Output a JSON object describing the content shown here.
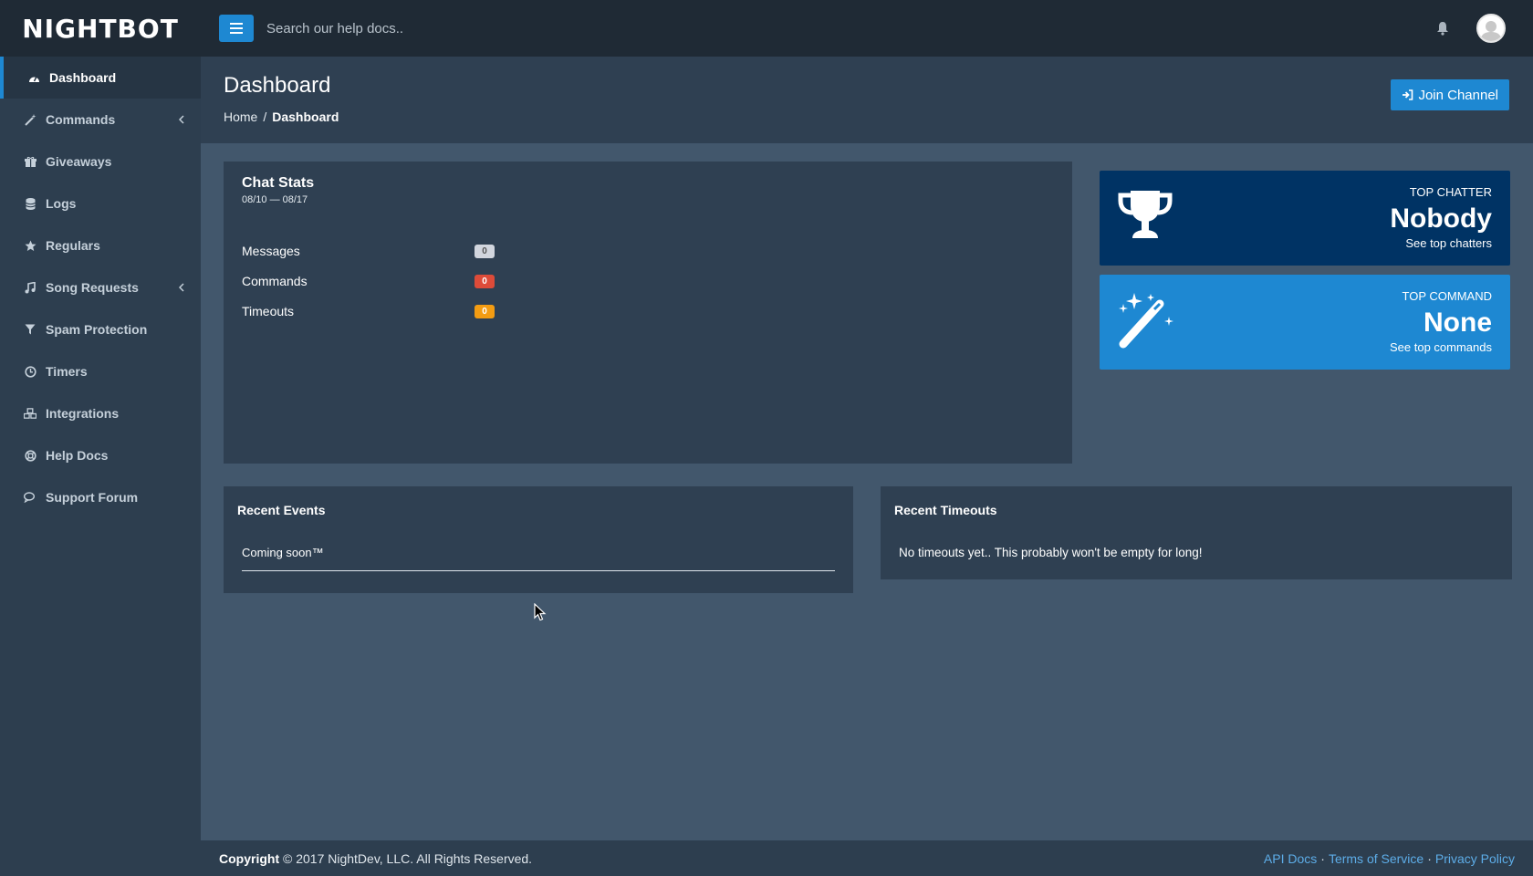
{
  "header": {
    "logo": "NIGHTBOT",
    "search_placeholder": "Search our help docs.."
  },
  "sidebar": {
    "items": [
      {
        "label": "Dashboard",
        "icon": "dashboard-icon",
        "active": true
      },
      {
        "label": "Commands",
        "icon": "magic-wand-icon",
        "has_submenu": true
      },
      {
        "label": "Giveaways",
        "icon": "gift-icon"
      },
      {
        "label": "Logs",
        "icon": "database-icon"
      },
      {
        "label": "Regulars",
        "icon": "star-icon"
      },
      {
        "label": "Song Requests",
        "icon": "music-icon",
        "has_submenu": true
      },
      {
        "label": "Spam Protection",
        "icon": "filter-icon"
      },
      {
        "label": "Timers",
        "icon": "clock-icon"
      },
      {
        "label": "Integrations",
        "icon": "cubes-icon"
      },
      {
        "label": "Help Docs",
        "icon": "life-ring-icon"
      },
      {
        "label": "Support Forum",
        "icon": "comments-icon"
      }
    ]
  },
  "page": {
    "title": "Dashboard",
    "breadcrumb_home": "Home",
    "breadcrumb_sep": "/",
    "breadcrumb_current": "Dashboard",
    "join_label": "Join Channel"
  },
  "chat_stats": {
    "title": "Chat Stats",
    "range": "08/10 — 08/17",
    "rows": [
      {
        "label": "Messages",
        "value": "0",
        "color": "#d2d6de"
      },
      {
        "label": "Commands",
        "value": "0",
        "color": "#dd4b39"
      },
      {
        "label": "Timeouts",
        "value": "0",
        "color": "#f39c12"
      }
    ]
  },
  "top_chatter": {
    "label": "TOP CHATTER",
    "value": "Nobody",
    "link": "See top chatters"
  },
  "top_command": {
    "label": "TOP COMMAND",
    "value": "None",
    "link": "See top commands"
  },
  "recent_events": {
    "title": "Recent Events",
    "body": "Coming soon™"
  },
  "recent_timeouts": {
    "title": "Recent Timeouts",
    "body": "No timeouts yet.. This probably won't be empty for long!"
  },
  "footer": {
    "copyright_bold": "Copyright",
    "copyright_rest": "© 2017 NightDev, LLC. All Rights Reserved.",
    "links": [
      "API Docs",
      "Terms of Service",
      "Privacy Policy"
    ],
    "separator": "·"
  },
  "colors": {
    "accent": "#1e88d2",
    "top_chatter_bg": "#003364",
    "content_bg": "#42576c",
    "panel_bg": "#2f4052"
  }
}
